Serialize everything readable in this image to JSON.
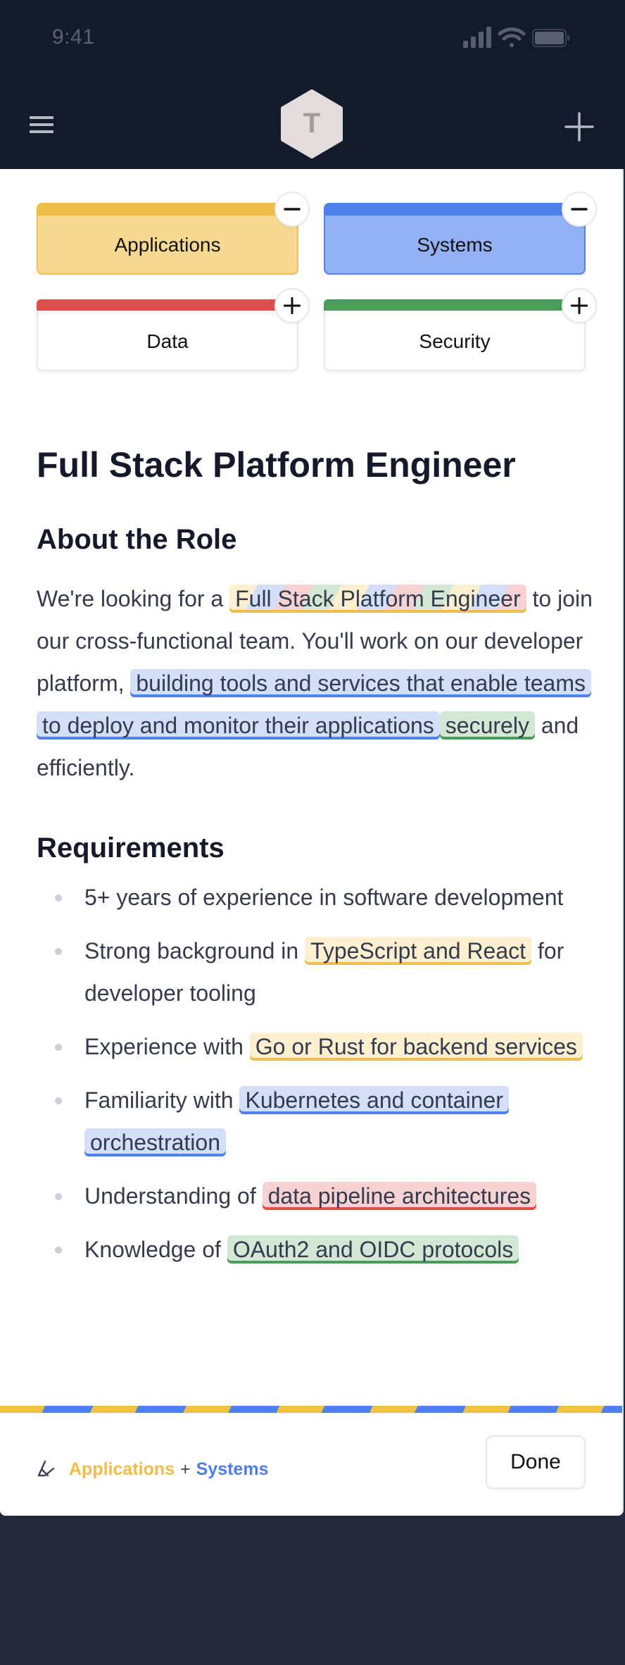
{
  "status_bar": {
    "time": "9:41",
    "icons": [
      "cellular-signal-icon",
      "wifi-icon",
      "battery-icon"
    ]
  },
  "nav": {
    "menu_icon": "hamburger-menu-icon",
    "logo_letter": "T",
    "add_icon": "plus-icon"
  },
  "categories": [
    {
      "label": "Applications",
      "selected": true,
      "toggle": "minus",
      "color": "#efbd49"
    },
    {
      "label": "Systems",
      "selected": true,
      "toggle": "minus",
      "color": "#4f81ec"
    },
    {
      "label": "Data",
      "selected": false,
      "toggle": "plus",
      "color": "#dd4f4b"
    },
    {
      "label": "Security",
      "selected": false,
      "toggle": "plus",
      "color": "#4a9d58"
    }
  ],
  "document": {
    "title": "Full Stack Platform Engineer",
    "about_heading": "About the Role",
    "about": {
      "t1": "We're looking for a ",
      "h1": "Full Stack Platform Engineer",
      "t2": " to join our cross-functional team. You'll work on our developer platform, ",
      "h2": "building tools and services that enable teams to deploy and monitor their applications",
      "h3": "securely",
      "t3": " and efficiently."
    },
    "requirements_heading": "Requirements",
    "requirements": [
      {
        "pre": "5+ years of experience in software development",
        "hl": "",
        "post": "",
        "category": ""
      },
      {
        "pre": "Strong background in ",
        "hl": "TypeScript and React",
        "post": " for developer tooling",
        "category": "Applications"
      },
      {
        "pre": "Experience with ",
        "hl": "Go or Rust for backend services",
        "post": "",
        "category": "Applications"
      },
      {
        "pre": "Familiarity with ",
        "hl": "Kubernetes and container orchestration",
        "post": "",
        "category": "Systems"
      },
      {
        "pre": "Understanding of ",
        "hl": "data pipeline architectures",
        "post": "",
        "category": "Data"
      },
      {
        "pre": "Knowledge of ",
        "hl": "OAuth2 and OIDC protocols",
        "post": "",
        "category": "Security"
      }
    ]
  },
  "footer": {
    "icon": "pen-icon",
    "selection_a": "Applications",
    "plus": "+",
    "selection_b": "Systems",
    "done_label": "Done"
  },
  "colors": {
    "applications": "#efbd49",
    "systems": "#4f81ec",
    "data": "#dd4f4b",
    "security": "#4a9d58",
    "header_bg": "#131a2b"
  }
}
